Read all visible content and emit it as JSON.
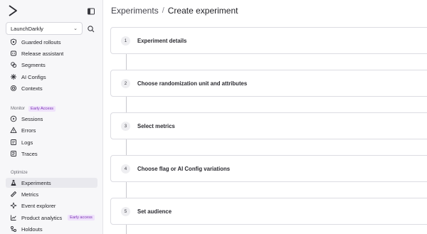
{
  "sidebar": {
    "org_name": "LaunchDarkly",
    "items_top": [
      {
        "label": "Guarded rollouts",
        "icon": "shield-icon"
      },
      {
        "label": "Release assistant",
        "icon": "release-assistant-icon"
      },
      {
        "label": "Segments",
        "icon": "segments-icon"
      },
      {
        "label": "AI Configs",
        "icon": "ai-configs-icon"
      },
      {
        "label": "Contexts",
        "icon": "contexts-icon"
      }
    ],
    "monitor": {
      "title": "Monitor",
      "badge": "Early Access",
      "items": [
        {
          "label": "Sessions",
          "icon": "play-circle-icon"
        },
        {
          "label": "Errors",
          "icon": "warning-triangle-icon"
        },
        {
          "label": "Logs",
          "icon": "logs-icon"
        },
        {
          "label": "Traces",
          "icon": "traces-icon"
        }
      ]
    },
    "optimize": {
      "title": "Optimize",
      "items": [
        {
          "label": "Experiments",
          "icon": "flask-icon",
          "active": true
        },
        {
          "label": "Metrics",
          "icon": "ruler-icon"
        },
        {
          "label": "Event explorer",
          "icon": "sparkle-icon"
        },
        {
          "label": "Product analytics",
          "icon": "chart-icon",
          "badge": "Early access"
        },
        {
          "label": "Holdouts",
          "icon": "holdouts-icon"
        }
      ]
    }
  },
  "breadcrumb": {
    "parent": "Experiments",
    "separator": "/",
    "current": "Create experiment"
  },
  "steps": [
    {
      "number": "1",
      "label": "Experiment details"
    },
    {
      "number": "2",
      "label": "Choose randomization unit and attributes"
    },
    {
      "number": "3",
      "label": "Select metrics"
    },
    {
      "number": "4",
      "label": "Choose flag or AI Config variations"
    },
    {
      "number": "5",
      "label": "Set audience"
    }
  ]
}
